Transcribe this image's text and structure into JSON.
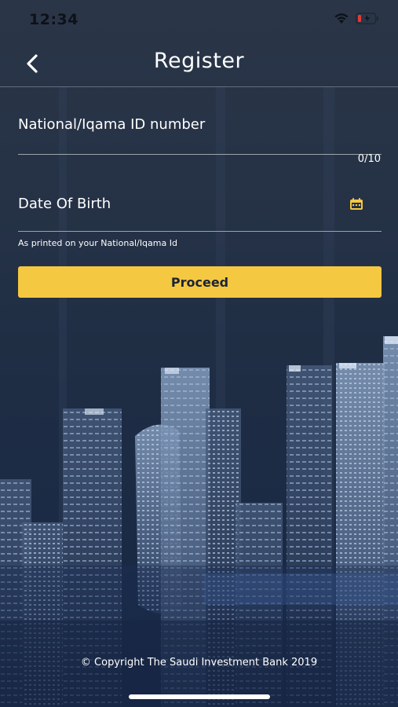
{
  "status_bar": {
    "time": "12:34"
  },
  "nav": {
    "title": "Register",
    "back_icon": "chevron-left-icon"
  },
  "form": {
    "id_field": {
      "placeholder": "National/Iqama ID number",
      "value": "",
      "counter": "0/10"
    },
    "dob_field": {
      "placeholder": "Date Of Birth",
      "value": "",
      "icon": "calendar-icon",
      "hint": "As printed on your National/Iqama Id"
    },
    "proceed_label": "Proceed"
  },
  "footer": {
    "copyright": "© Copyright The Saudi Investment Bank 2019"
  },
  "colors": {
    "accent": "#f5c842",
    "background": "#1e2d44",
    "battery_low": "#e53935"
  }
}
